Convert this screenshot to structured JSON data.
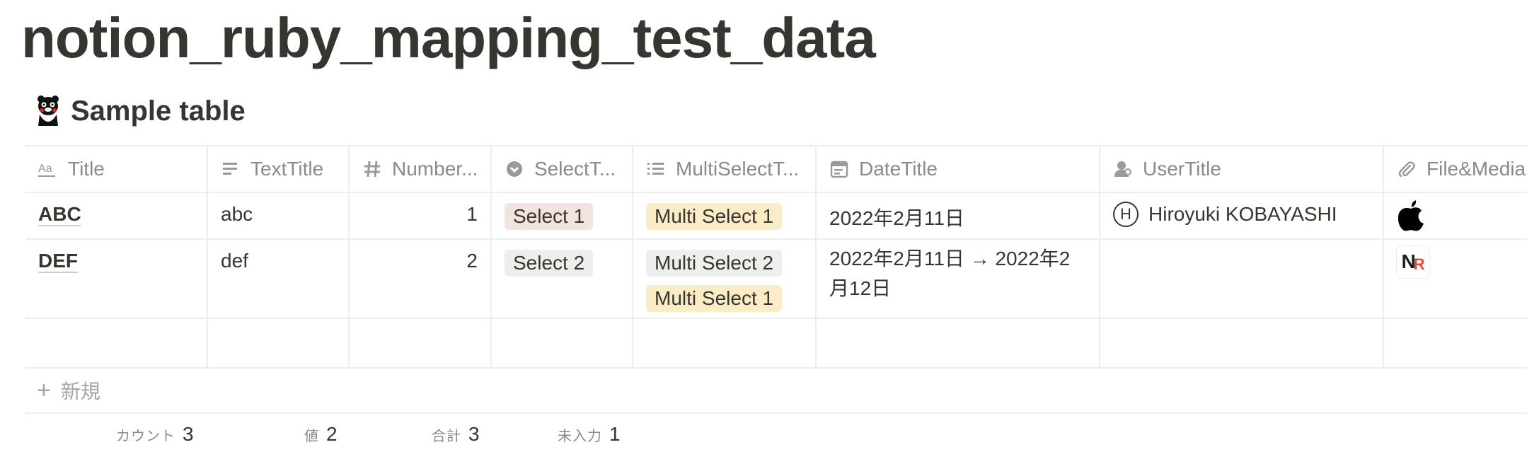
{
  "page": {
    "title": "notion_ruby_mapping_test_data"
  },
  "database": {
    "icon": "kumamon-bear-icon",
    "title": "Sample table",
    "columns": [
      {
        "label": "Title",
        "icon": "title-aa-icon"
      },
      {
        "label": "TextTitle",
        "icon": "text-lines-icon"
      },
      {
        "label": "Number...",
        "icon": "hash-icon"
      },
      {
        "label": "SelectT...",
        "icon": "select-chevron-circle-icon"
      },
      {
        "label": "MultiSelectT...",
        "icon": "list-icon"
      },
      {
        "label": "DateTitle",
        "icon": "calendar-icon"
      },
      {
        "label": "UserTitle",
        "icon": "user-icon"
      },
      {
        "label": "File&Media",
        "icon": "paperclip-icon"
      }
    ],
    "rows": [
      {
        "title": "ABC",
        "text": "abc",
        "number": "1",
        "select": {
          "label": "Select 1",
          "color": "#f2e3e0"
        },
        "multi_select": [
          {
            "label": "Multi Select 1",
            "color": "#fbecc8"
          }
        ],
        "date": "2022年2月11日",
        "user": {
          "avatar_letter": "H",
          "name": "Hiroyuki KOBAYASHI"
        },
        "file_icon": "apple-logo-icon"
      },
      {
        "title": "DEF",
        "text": "def",
        "number": "2",
        "select": {
          "label": "Select 2",
          "color": "#eeeeec"
        },
        "multi_select": [
          {
            "label": "Multi Select 2",
            "color": "#eeeeec"
          },
          {
            "label": "Multi Select 1",
            "color": "#fbecc8"
          }
        ],
        "date": "2022年2月11日 → 2022年2月12日",
        "user": null,
        "file_icon": "nr-logo-icon"
      }
    ],
    "new_row_label": "新規",
    "footer": [
      {
        "label": "カウント",
        "value": "3"
      },
      {
        "label": "値",
        "value": "2"
      },
      {
        "label": "合計",
        "value": "3"
      },
      {
        "label": "未入力",
        "value": "1"
      }
    ]
  }
}
